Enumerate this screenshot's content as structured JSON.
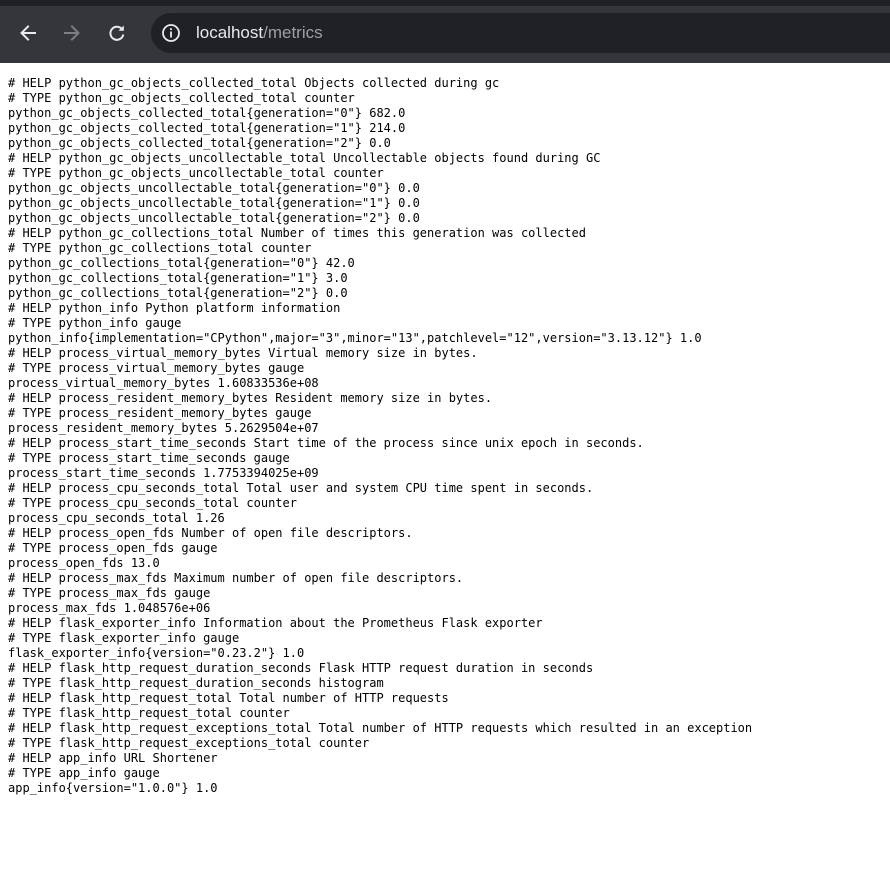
{
  "browser": {
    "url_host": "localhost",
    "url_path": "/metrics",
    "icons": {
      "back": "arrow-left-icon",
      "forward": "arrow-right-icon",
      "reload": "reload-icon",
      "site_info": "info-icon"
    }
  },
  "metrics_lines": [
    "# HELP python_gc_objects_collected_total Objects collected during gc",
    "# TYPE python_gc_objects_collected_total counter",
    "python_gc_objects_collected_total{generation=\"0\"} 682.0",
    "python_gc_objects_collected_total{generation=\"1\"} 214.0",
    "python_gc_objects_collected_total{generation=\"2\"} 0.0",
    "# HELP python_gc_objects_uncollectable_total Uncollectable objects found during GC",
    "# TYPE python_gc_objects_uncollectable_total counter",
    "python_gc_objects_uncollectable_total{generation=\"0\"} 0.0",
    "python_gc_objects_uncollectable_total{generation=\"1\"} 0.0",
    "python_gc_objects_uncollectable_total{generation=\"2\"} 0.0",
    "# HELP python_gc_collections_total Number of times this generation was collected",
    "# TYPE python_gc_collections_total counter",
    "python_gc_collections_total{generation=\"0\"} 42.0",
    "python_gc_collections_total{generation=\"1\"} 3.0",
    "python_gc_collections_total{generation=\"2\"} 0.0",
    "# HELP python_info Python platform information",
    "# TYPE python_info gauge",
    "python_info{implementation=\"CPython\",major=\"3\",minor=\"13\",patchlevel=\"12\",version=\"3.13.12\"} 1.0",
    "# HELP process_virtual_memory_bytes Virtual memory size in bytes.",
    "# TYPE process_virtual_memory_bytes gauge",
    "process_virtual_memory_bytes 1.60833536e+08",
    "# HELP process_resident_memory_bytes Resident memory size in bytes.",
    "# TYPE process_resident_memory_bytes gauge",
    "process_resident_memory_bytes 5.2629504e+07",
    "# HELP process_start_time_seconds Start time of the process since unix epoch in seconds.",
    "# TYPE process_start_time_seconds gauge",
    "process_start_time_seconds 1.7753394025e+09",
    "# HELP process_cpu_seconds_total Total user and system CPU time spent in seconds.",
    "# TYPE process_cpu_seconds_total counter",
    "process_cpu_seconds_total 1.26",
    "# HELP process_open_fds Number of open file descriptors.",
    "# TYPE process_open_fds gauge",
    "process_open_fds 13.0",
    "# HELP process_max_fds Maximum number of open file descriptors.",
    "# TYPE process_max_fds gauge",
    "process_max_fds 1.048576e+06",
    "# HELP flask_exporter_info Information about the Prometheus Flask exporter",
    "# TYPE flask_exporter_info gauge",
    "flask_exporter_info{version=\"0.23.2\"} 1.0",
    "# HELP flask_http_request_duration_seconds Flask HTTP request duration in seconds",
    "# TYPE flask_http_request_duration_seconds histogram",
    "# HELP flask_http_request_total Total number of HTTP requests",
    "# TYPE flask_http_request_total counter",
    "# HELP flask_http_request_exceptions_total Total number of HTTP requests which resulted in an exception",
    "# TYPE flask_http_request_exceptions_total counter",
    "# HELP app_info URL Shortener",
    "# TYPE app_info gauge",
    "app_info{version=\"1.0.0\"} 1.0"
  ]
}
